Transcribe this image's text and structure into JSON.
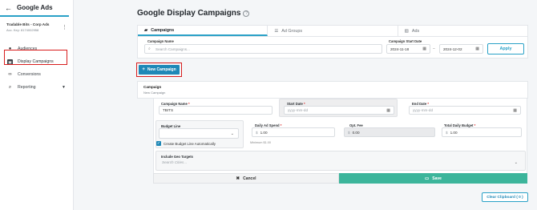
{
  "app": {
    "title": "Google Ads"
  },
  "account": {
    "name": "Tradable Bits - Corp Ads",
    "key": "Acc. Key: 8174002958"
  },
  "sidebar": {
    "items": [
      {
        "label": "Audiences",
        "icon": "users-icon"
      },
      {
        "label": "Display Campaigns",
        "icon": "display-campaigns-icon",
        "active": true
      },
      {
        "label": "Conversions",
        "icon": "link-icon"
      },
      {
        "label": "Reporting",
        "icon": "search-chart-icon",
        "has_caret": true
      }
    ]
  },
  "page": {
    "title": "Google Display Campaigns",
    "help": "?"
  },
  "tabs": [
    {
      "label": "Campaigns",
      "icon": "folder-icon",
      "active": true
    },
    {
      "label": "Ad Groups",
      "icon": "list-icon"
    },
    {
      "label": "Ads",
      "icon": "image-icon"
    }
  ],
  "filters": {
    "campaign_name_label": "Campaign Name",
    "campaign_name_placeholder": "Search Campaigns...",
    "start_date_label": "Campaign Start Date",
    "start_date_from": "2024-11-18",
    "start_date_to": "2024-12-02",
    "range_sep": "–",
    "apply_label": "Apply"
  },
  "new_campaign_label": "New Campaign",
  "campaign_section": {
    "title": "Campaign",
    "subtitle": "New Campaign"
  },
  "form": {
    "campaign_name_label": "Campaign Name",
    "campaign_name_value": "TBITS",
    "start_date_label": "Start Date",
    "start_date_placeholder": "yyyy-mm-dd",
    "end_date_label": "End Date",
    "end_date_placeholder": "yyyy-mm-dd",
    "budget_line_label": "Budget Line",
    "create_budget_line_label": "Create Budget Line Automatically",
    "daily_ad_spend_label": "Daily Ad Spend",
    "daily_ad_spend_value": "1.00",
    "minimum_hint": "Minimum $1.00",
    "opt_fee_label": "Opt. Fee",
    "opt_fee_value": "0.00",
    "total_daily_budget_label": "Total Daily Budget",
    "total_daily_budget_value": "1.00",
    "currency_symbol": "$",
    "required_mark": "*",
    "geo_targets_label": "Include Geo Targets",
    "geo_targets_placeholder": "Search Cities...",
    "cancel_label": "Cancel",
    "save_label": "Save"
  },
  "clear_clipboard_label": "Clear Clipboard ( 0 )",
  "colors": {
    "accent": "#2aa1c7",
    "primary_button": "#1e88b7",
    "save": "#3cb59b",
    "highlight": "#d81e1e"
  }
}
